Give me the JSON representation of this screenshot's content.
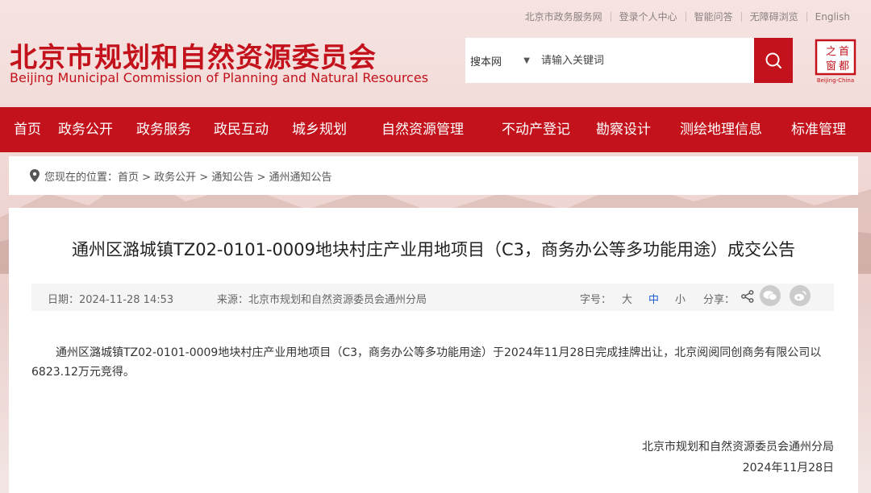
{
  "top_links": [
    "北京市政务服务网",
    "登录个人中心",
    "智能问答",
    "无障碍浏览",
    "English"
  ],
  "logo": {
    "cn": "北京市规划和自然资源委员会",
    "en": "Beijing Municipal Commission of Planning and Natural Resources"
  },
  "search": {
    "scope": "搜本网",
    "placeholder": "请输入关键词"
  },
  "seal": {
    "chars": "首都之窗",
    "en": "Beijing-China"
  },
  "nav": [
    "首页",
    "政务公开",
    "政务服务",
    "政民互动",
    "城乡规划",
    "自然资源管理",
    "不动产登记",
    "勘察设计",
    "测绘地理信息",
    "标准管理"
  ],
  "breadcrumb": {
    "prefix": "您现在的位置：",
    "path": "首页 > 政务公开 > 通知公告 > 通州通知公告"
  },
  "article": {
    "title": "通州区潞城镇TZ02-0101-0009地块村庄产业用地项目（C3，商务办公等多功能用途）成交公告",
    "date": "日期：2024-11-28 14:53",
    "source": "来源：北京市规划和自然资源委员会通州分局",
    "font_label": "字号：",
    "font_sizes": [
      "大",
      "中",
      "小"
    ],
    "share_label": "分享：",
    "body": "通州区潞城镇TZ02-0101-0009地块村庄产业用地项目（C3，商务办公等多功能用途）于2024年11月28日完成挂牌出让，北京阅阅同创商务有限公司以6823.12万元竞得。",
    "sign_org": "北京市规划和自然资源委员会通州分局",
    "sign_date": "2024年11月28日"
  },
  "colors": {
    "brand_red": "#c3121b",
    "active_font": "#1e5fd1"
  }
}
